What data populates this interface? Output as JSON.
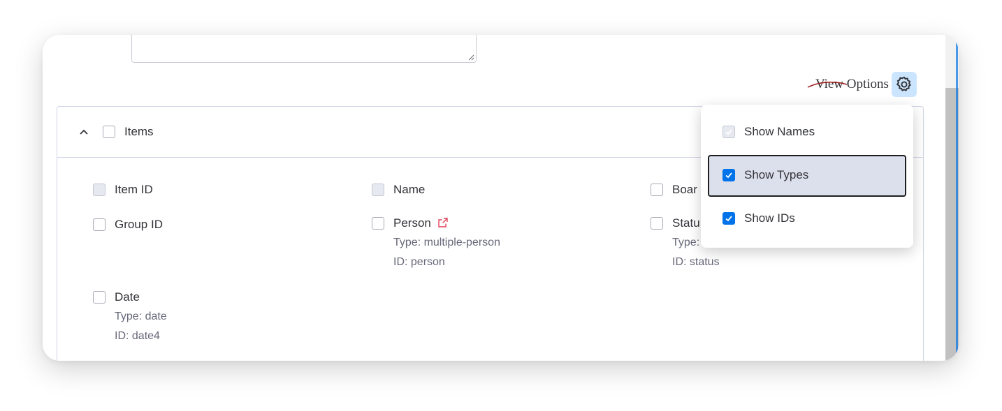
{
  "view_options": {
    "label": "View Options",
    "icon": "gear-icon"
  },
  "panel": {
    "title": "Items",
    "fields": [
      {
        "name": "Item ID"
      },
      {
        "name": "Name"
      },
      {
        "name": "Boar"
      },
      {
        "name": "Group ID"
      },
      {
        "name": "Person",
        "type": "Type: multiple-person",
        "id": "ID: person"
      },
      {
        "name": "Statu",
        "type": "Type:",
        "id": "ID: status"
      },
      {
        "name": "Date",
        "type": "Type: date",
        "id": "ID: date4"
      }
    ]
  },
  "dropdown": {
    "options": [
      {
        "label": "Show Names",
        "checked": true,
        "disabled": true
      },
      {
        "label": "Show Types",
        "checked": true
      },
      {
        "label": "Show IDs",
        "checked": true
      }
    ]
  },
  "colors": {
    "accent": "#0073ea",
    "link_icon": "#e2445c"
  }
}
